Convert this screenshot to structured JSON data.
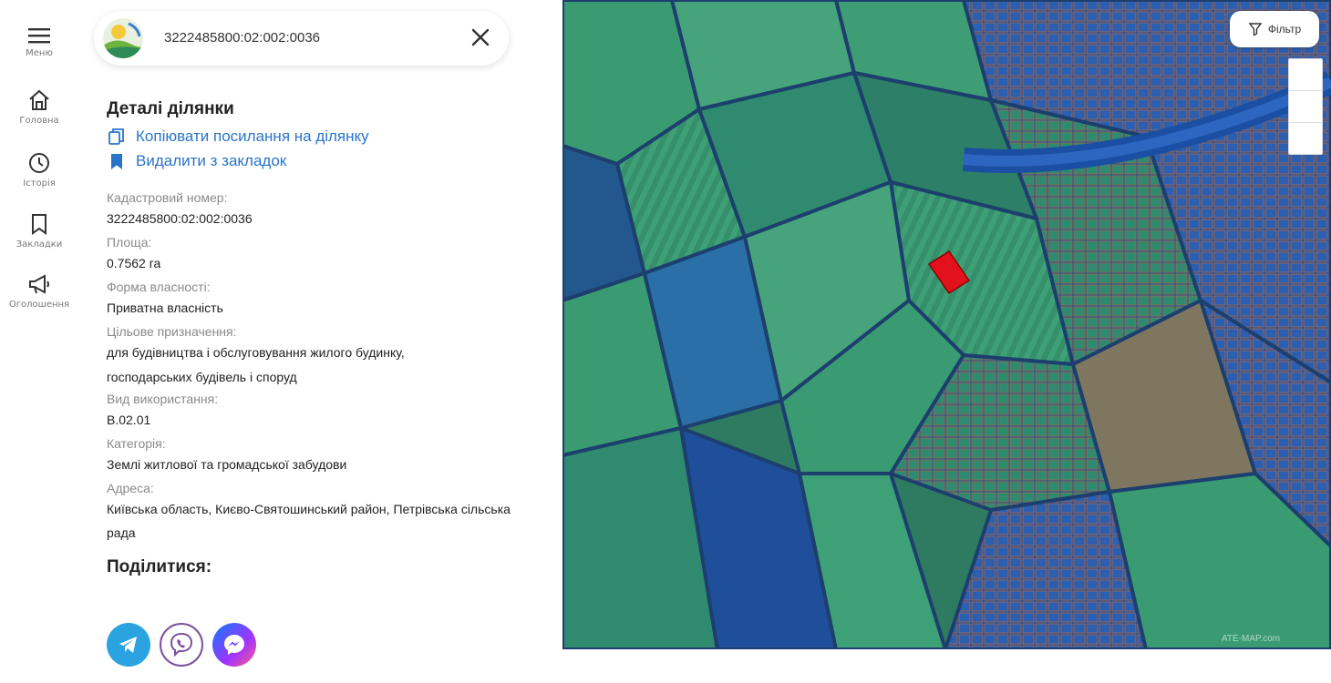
{
  "nav": {
    "menu": "Меню",
    "home": "Головна",
    "history": "Історія",
    "bookmarks": "Закладки",
    "ads": "Оголошення"
  },
  "search": {
    "value": "3222485800:02:002:0036"
  },
  "details": {
    "title": "Деталі ділянки",
    "copy_link": "Копіювати посилання на ділянку",
    "remove_bookmark": "Видалити з закладок",
    "fields": [
      {
        "label": "Кадастровий номер:",
        "value": "3222485800:02:002:0036"
      },
      {
        "label": "Площа:",
        "value": "0.7562 га"
      },
      {
        "label": "Форма власності:",
        "value": "Приватна власність"
      },
      {
        "label": "Цільове призначення:",
        "value": "для будівництва і обслуговування жилого будинку, господарських будівель і споруд"
      },
      {
        "label": "Вид використання:",
        "value": "В.02.01"
      },
      {
        "label": "Категорія:",
        "value": "Землі житлової та громадської забудови"
      },
      {
        "label": "Адреса:",
        "value": "Київська область, Києво-Святошинський район, Петрівська сільська рада"
      }
    ]
  },
  "share": {
    "title": "Поділитися:",
    "buttons": [
      "telegram-icon",
      "viber-icon",
      "messenger-icon"
    ]
  },
  "map": {
    "filter_label": "Фільтр",
    "attribution": "ATE-MAP.com",
    "highlight_color": "#e3111b",
    "colors": [
      "#2f7b62",
      "#1f4f9a",
      "#3a9b72",
      "#2a6fa8"
    ]
  }
}
